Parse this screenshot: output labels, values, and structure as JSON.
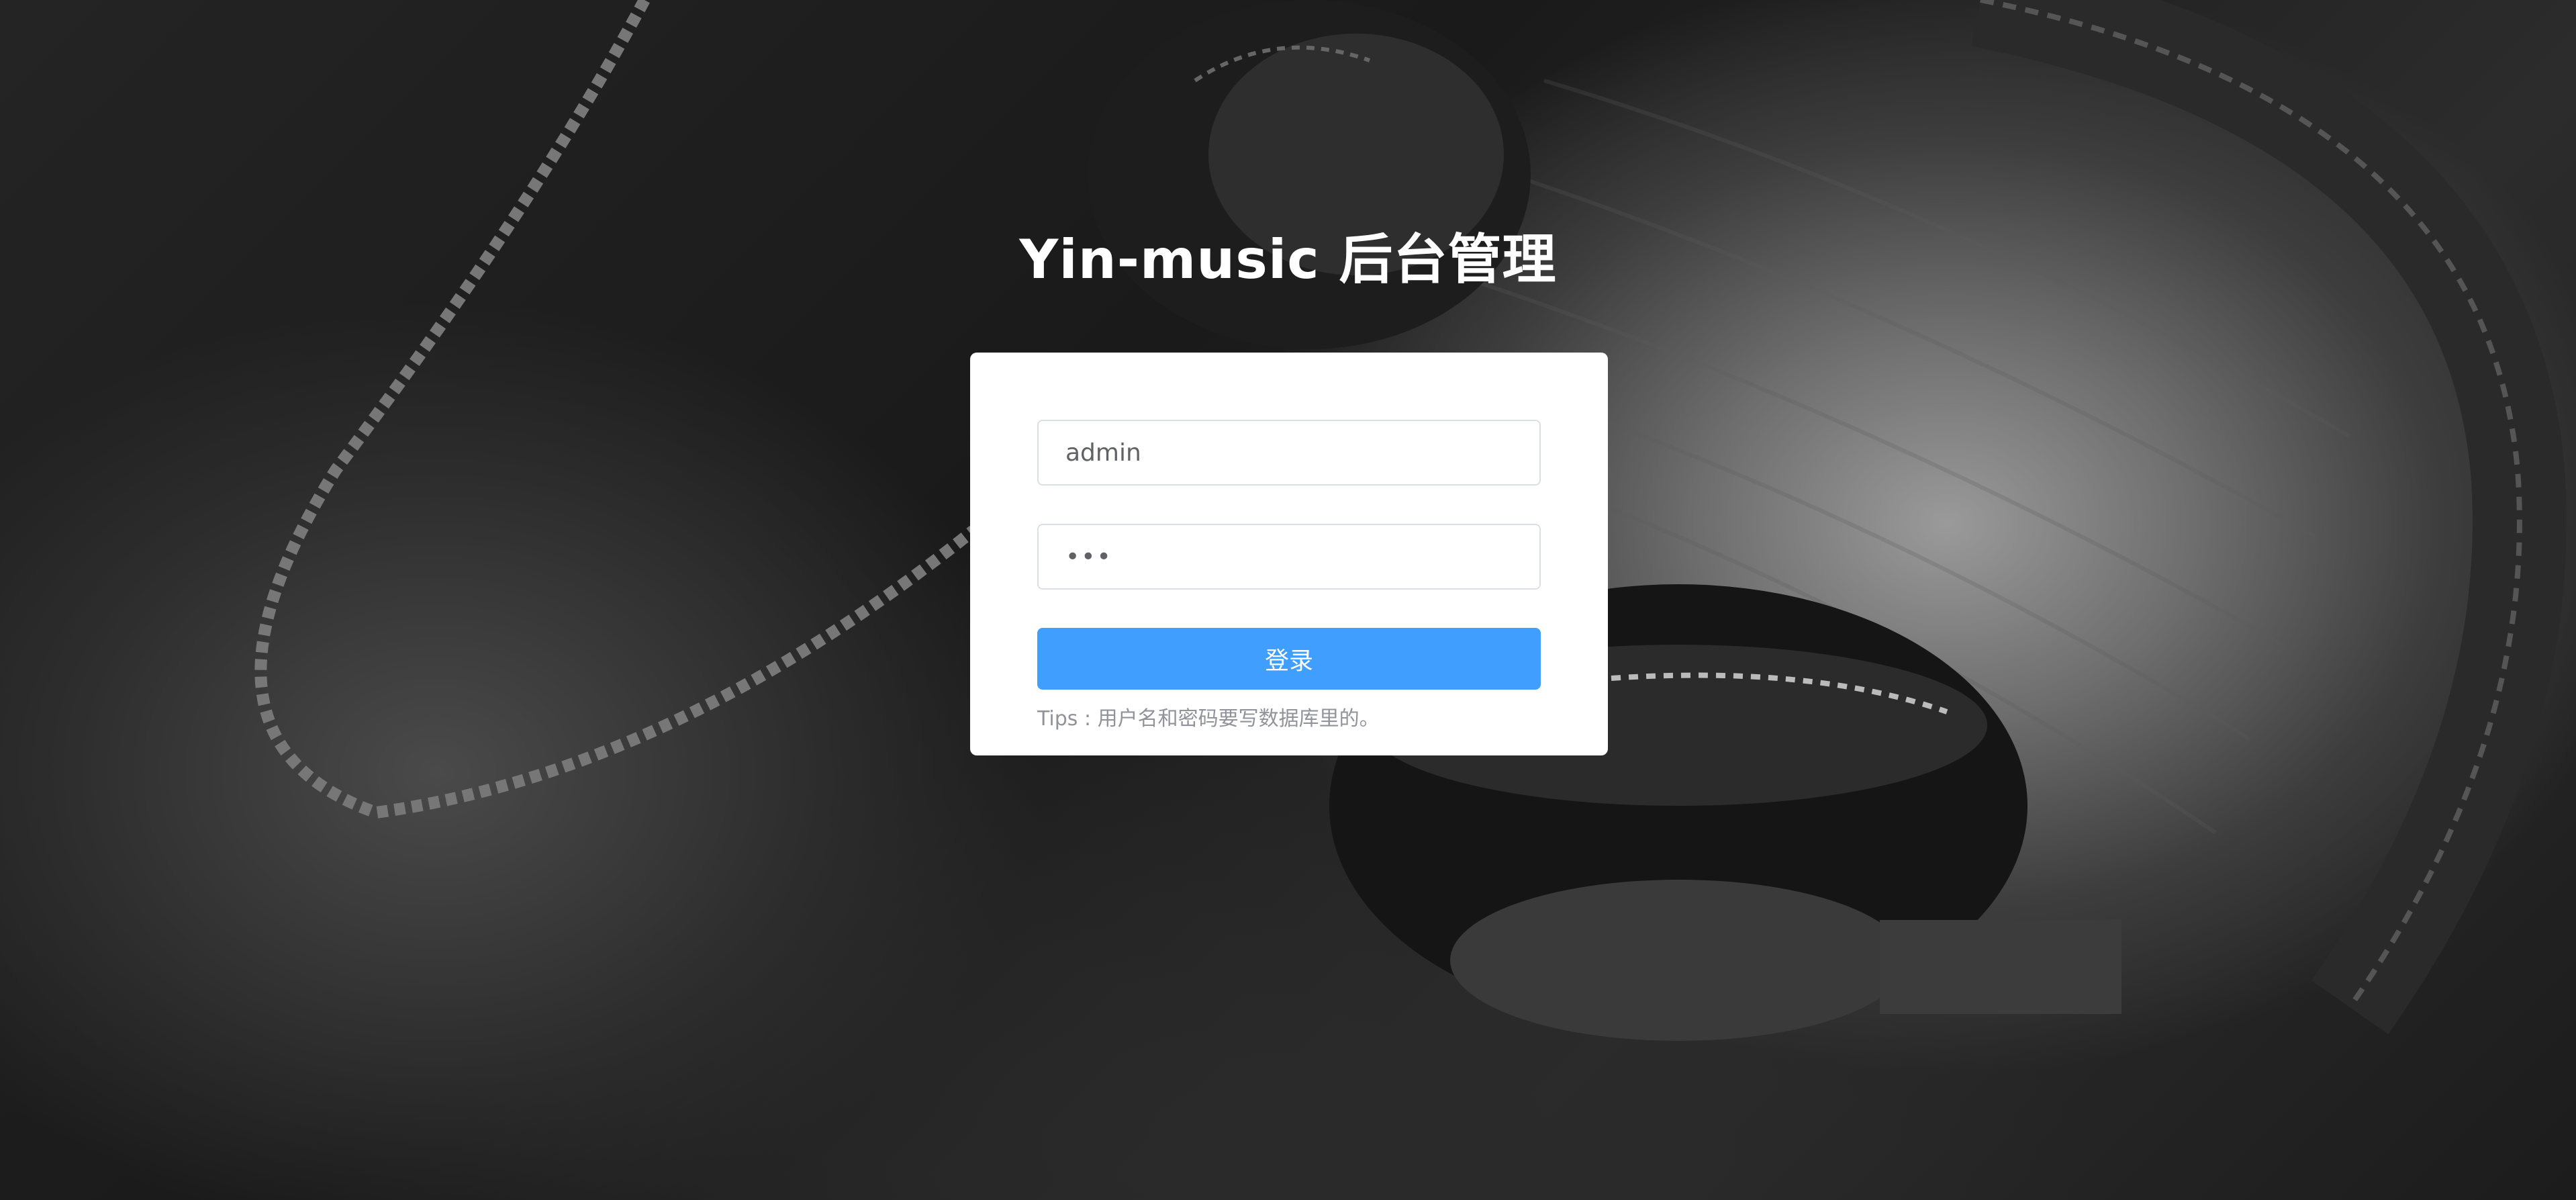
{
  "page": {
    "title": "Yin-music 后台管理"
  },
  "login": {
    "username_value": "admin",
    "password_value": "•••",
    "submit_label": "登录",
    "tips": "Tips : 用户名和密码要写数据库里的。"
  },
  "background": {
    "subject": "headphones-photo",
    "tone": "grayscale"
  },
  "colors": {
    "primary_button": "#409eff",
    "card": "#ffffff",
    "tips_text": "#909399",
    "title_text": "#ffffff"
  }
}
